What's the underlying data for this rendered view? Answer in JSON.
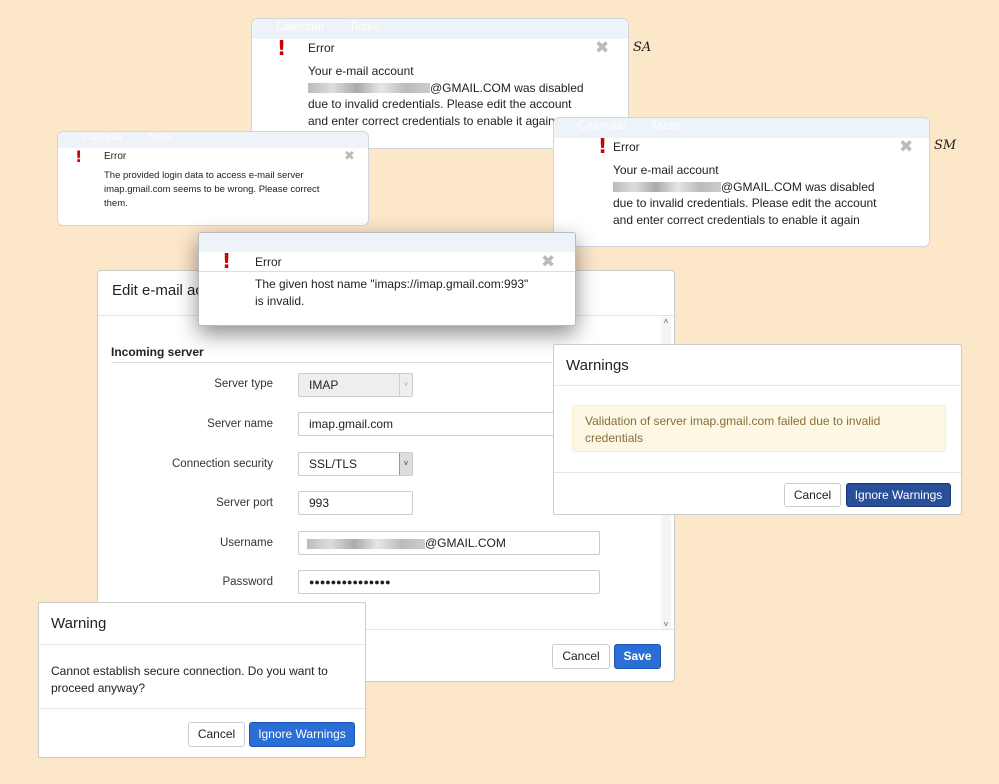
{
  "bg_color": "#fde7c9",
  "band_tabs": [
    "Calendar",
    "Tasks"
  ],
  "error_sa": {
    "title": "Error",
    "line1": "Your e-mail account",
    "email_suffix": "@GMAIL.COM was disabled",
    "line3": "due to invalid credentials. Please edit the account",
    "line4": "and enter correct credentials to enable it again",
    "tag": "SA"
  },
  "error_small": {
    "title": "Error",
    "line1": "The provided login data to access e-mail server",
    "line2": "imap.gmail.com seems to be wrong. Please correct",
    "line3": "them."
  },
  "error_sm": {
    "title": "Error",
    "line1": "Your e-mail account",
    "email_suffix": "@GMAIL.COM was disabled",
    "line3": "due to invalid credentials. Please edit the account",
    "line4": "and enter correct credentials to enable it again",
    "tag": "SM"
  },
  "error_host": {
    "title": "Error",
    "line1": "The given host name \"imaps://imap.gmail.com:993\"",
    "line2": "is invalid."
  },
  "edit": {
    "title": "Edit e-mail account",
    "section": "Incoming server",
    "fields": {
      "server_type": {
        "label": "Server type",
        "value": "IMAP"
      },
      "server_name": {
        "label": "Server name",
        "value": "imap.gmail.com"
      },
      "security": {
        "label": "Connection security",
        "value": "SSL/TLS"
      },
      "port": {
        "label": "Server port",
        "value": "993"
      },
      "username": {
        "label": "Username",
        "value": "@GMAIL.COM"
      },
      "password": {
        "label": "Password",
        "value": "●●●●●●●●●●●●●●●"
      }
    },
    "cancel": "Cancel",
    "save": "Save"
  },
  "warnings": {
    "title": "Warnings",
    "message": "Validation of server imap.gmail.com failed due to invalid credentials",
    "cancel": "Cancel",
    "ignore": "Ignore Warnings"
  },
  "warning": {
    "title": "Warning",
    "message": "Cannot establish secure connection. Do you want to proceed anyway?",
    "cancel": "Cancel",
    "ignore": "Ignore Warnings"
  },
  "colors": {
    "error": "#cc0000",
    "primary": "#2b6fd6",
    "alert_bg": "#fcf8e3",
    "alert_text": "#8a6d3b"
  }
}
